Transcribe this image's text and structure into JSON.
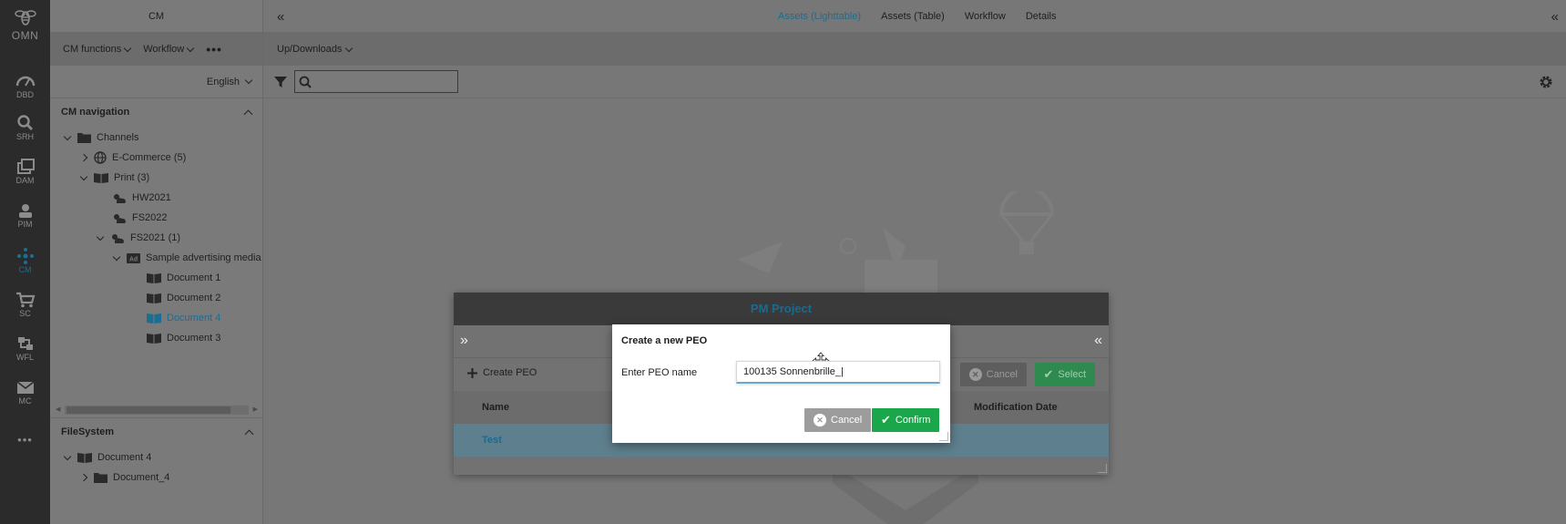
{
  "rail": {
    "logo_text": "OMN",
    "items": [
      {
        "label": "DBD",
        "icon": "dashboard-icon"
      },
      {
        "label": "SRH",
        "icon": "search-icon"
      },
      {
        "label": "DAM",
        "icon": "images-icon"
      },
      {
        "label": "PIM",
        "icon": "pim-icon"
      },
      {
        "label": "CM",
        "icon": "cm-icon",
        "active": true
      },
      {
        "label": "SC",
        "icon": "cart-icon"
      },
      {
        "label": "WFL",
        "icon": "workflow-icon"
      },
      {
        "label": "MC",
        "icon": "mail-icon"
      }
    ],
    "more": "•••",
    "active_color": "#1a6e93"
  },
  "cm": {
    "title": "CM",
    "menu": [
      "CM functions",
      "Workflow"
    ],
    "language": "English",
    "nav_title": "CM navigation",
    "tree": [
      {
        "label": "Channels"
      },
      {
        "label": "E-Commerce (5)"
      },
      {
        "label": "Print (3)"
      },
      {
        "label": "HW2021"
      },
      {
        "label": "FS2022"
      },
      {
        "label": "FS2021 (1)"
      },
      {
        "label": "Sample advertising media"
      },
      {
        "label": "Document 1"
      },
      {
        "label": "Document 2"
      },
      {
        "label": "Document 4",
        "selected": true
      },
      {
        "label": "Document 3"
      }
    ],
    "fs_title": "FileSystem",
    "fs_tree": [
      {
        "label": "Document 4"
      },
      {
        "label": "Document_4"
      }
    ]
  },
  "main": {
    "tabs": [
      "Assets (Lighttable)",
      "Assets (Table)",
      "Workflow",
      "Details"
    ],
    "active_tab": "Assets (Lighttable)",
    "toolbar_menu": "Up/Downloads",
    "search_value": ""
  },
  "pm_dialog": {
    "title": "PM Project",
    "create_label": "Create PEO",
    "cancel_label": "Cancel",
    "select_label": "Select",
    "col_name": "Name",
    "col_mod": "Modification Date",
    "rows": [
      {
        "name": "Test"
      }
    ]
  },
  "peo_dialog": {
    "title": "Create a new PEO",
    "field_label": "Enter PEO name",
    "field_value": "100135 Sonnenbrille_|",
    "cancel_label": "Cancel",
    "confirm_label": "Confirm"
  }
}
